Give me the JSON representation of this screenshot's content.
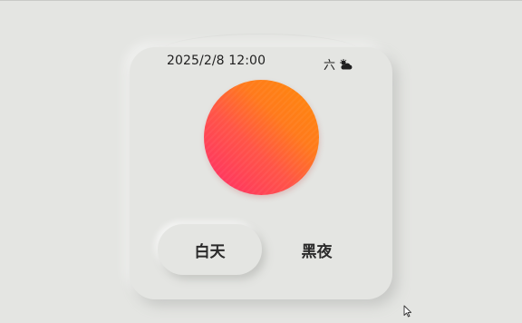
{
  "status_bar": {
    "datetime": "2025/2/8 12:00",
    "weekday": "六",
    "weather_icon": "partly-cloudy-icon"
  },
  "theme_toggle": {
    "day_label": "白天",
    "night_label": "黑夜",
    "selected": "白天"
  },
  "colors": {
    "background": "#e4e5e2",
    "sun_top": "#ff8a0a",
    "sun_bottom": "#ff2b6a"
  }
}
